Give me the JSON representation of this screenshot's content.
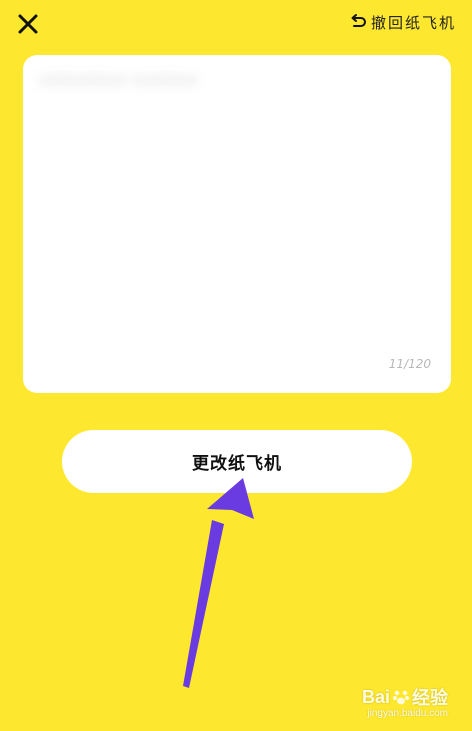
{
  "topbar": {
    "close_icon": "close-icon",
    "undo_icon": "undo-icon",
    "undo_label": "撤回纸飞机"
  },
  "card": {
    "blurred_text": "XXXXXXXX  XXXXXX",
    "counter": "11/120"
  },
  "actions": {
    "change_label": "更改纸飞机"
  },
  "watermark": {
    "logo_text": "Bai",
    "logo_suffix": "经验",
    "url": "jingyan.baidu.com"
  },
  "colors": {
    "background": "#FEE82F",
    "card": "#FFFFFF",
    "arrow": "#6A3BE0"
  }
}
